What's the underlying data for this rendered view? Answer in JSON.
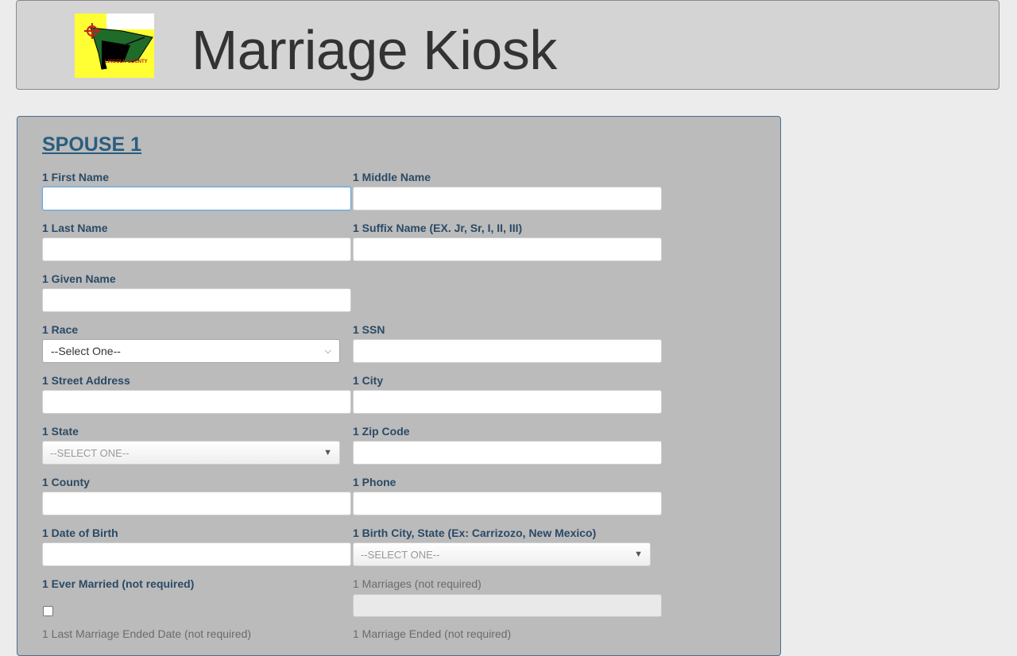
{
  "header": {
    "title": "Marriage Kiosk",
    "logo_text": "LINCOLN COUNTY"
  },
  "section": {
    "title": "SPOUSE 1"
  },
  "fields": {
    "first_name": "1 First Name",
    "middle_name": "1 Middle Name",
    "last_name": "1 Last Name",
    "suffix_name": "1 Suffix Name (EX. Jr, Sr, I, II, III)",
    "given_name": "1 Given Name",
    "race": "1 Race",
    "ssn": "1 SSN",
    "street": "1 Street Address",
    "city": "1 City",
    "state": "1 State",
    "zip": "1 Zip Code",
    "county": "1 County",
    "phone": "1 Phone",
    "dob": "1 Date of Birth",
    "birth_city": "1 Birth City, State (Ex: Carrizozo, New Mexico)",
    "ever_married": "1 Ever Married (not required)",
    "marriages": "1 Marriages (not required)",
    "last_marriage_ended": "1 Last Marriage Ended Date (not required)",
    "marriage_ended": "1 Marriage Ended (not required)"
  },
  "selects": {
    "race_value": "--Select One--",
    "state_value": "--SELECT ONE--",
    "birth_city_value": "--SELECT ONE--"
  },
  "colors": {
    "panel": "#bbbbbb",
    "label": "#2a4a66",
    "title": "#2b5d80"
  }
}
